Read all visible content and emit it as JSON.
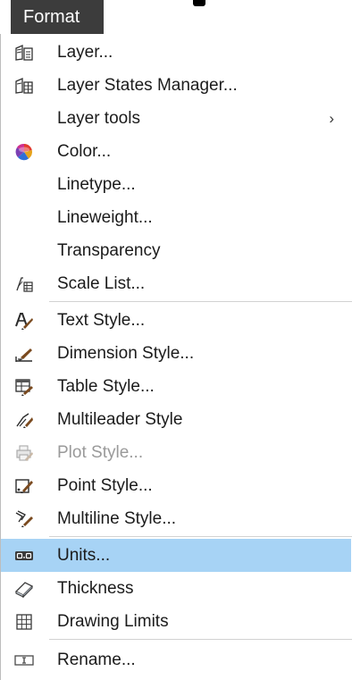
{
  "menubar": {
    "title": "Format"
  },
  "menu": {
    "items": [
      {
        "label": "Layer..."
      },
      {
        "label": "Layer States Manager..."
      },
      {
        "label": "Layer tools",
        "submenu": true
      },
      {
        "label": "Color..."
      },
      {
        "label": "Linetype..."
      },
      {
        "label": "Lineweight..."
      },
      {
        "label": "Transparency"
      },
      {
        "label": "Scale List..."
      },
      {
        "label": "Text Style..."
      },
      {
        "label": "Dimension Style..."
      },
      {
        "label": "Table Style..."
      },
      {
        "label": "Multileader Style"
      },
      {
        "label": "Plot Style...",
        "disabled": true
      },
      {
        "label": "Point Style..."
      },
      {
        "label": "Multiline Style..."
      },
      {
        "label": "Units...",
        "highlighted": true
      },
      {
        "label": "Thickness"
      },
      {
        "label": "Drawing Limits"
      },
      {
        "label": "Rename..."
      }
    ],
    "submenu_arrow": "›"
  },
  "colors": {
    "menubar_bg": "#3c3c3c",
    "highlight_bg": "#a7d3f5",
    "disabled_text": "#9a9a9a",
    "separator": "#d2d2d2"
  }
}
